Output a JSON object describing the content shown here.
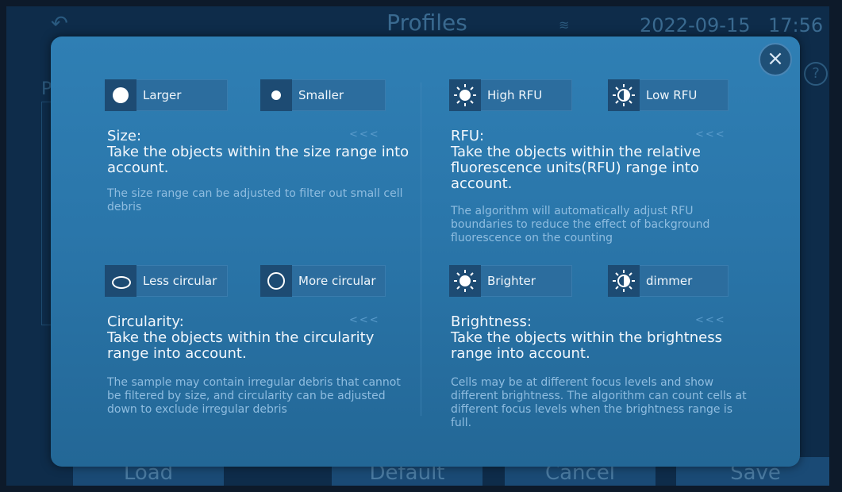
{
  "background": {
    "title": "Profiles",
    "date": "2022-09-15",
    "time": "17:56",
    "help": "?",
    "left_letter": "P",
    "buttons": {
      "load": "Load",
      "default": "Default",
      "cancel": "Cancel",
      "save": "Save"
    }
  },
  "modal": {
    "close": "×",
    "arrows": "<<<",
    "size": {
      "larger": "Larger",
      "smaller": "Smaller",
      "heading_label": "Size:",
      "heading": "Take the objects within the size range into account.",
      "desc": "The size range can be adjusted to filter out small cell debris"
    },
    "rfu": {
      "high": "High RFU",
      "low": "Low RFU",
      "heading_label": "RFU:",
      "heading": "Take the objects within the relative fluorescence units(RFU) range into account.",
      "desc": "The algorithm will automatically adjust RFU boundaries to reduce the effect of background fluorescence on the counting"
    },
    "circularity": {
      "less": "Less circular",
      "more": "More circular",
      "heading_label": "Circularity:",
      "heading": "Take the objects within the circularity range into account.",
      "desc": "The sample may contain irregular debris that cannot be filtered by size, and circularity can be adjusted down to exclude irregular debris"
    },
    "brightness": {
      "brighter": "Brighter",
      "dimmer": "dimmer",
      "heading_label": "Brightness:",
      "heading": "Take the objects within the brightness range into account.",
      "desc": "Cells may be at different focus levels and show different brightness. The algorithm can  count cells at different focus levels when the brightness range is full."
    }
  },
  "icons": {
    "back": "back-arrow-icon",
    "wifi": "wifi-icon",
    "sun": "sun-icon",
    "half_sun": "half-sun-icon"
  },
  "colors": {
    "modal_bg": "#2a76aa",
    "icon_bg": "#1d4b73",
    "desc_text": "#8fbde0"
  }
}
